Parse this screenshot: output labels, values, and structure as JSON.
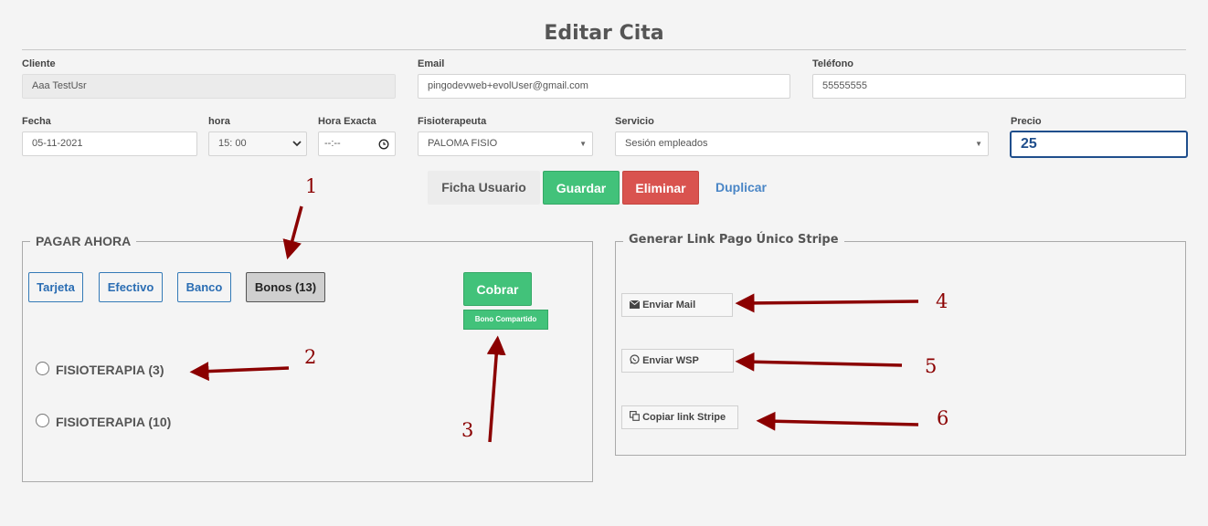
{
  "page": {
    "title": "Editar Cita"
  },
  "cliente": {
    "label": "Cliente",
    "value": "Aaa TestUsr"
  },
  "email": {
    "label": "Email",
    "value": "pingodevweb+evolUser@gmail.com"
  },
  "telefono": {
    "label": "Teléfono",
    "value": "55555555"
  },
  "fecha": {
    "label": "Fecha",
    "value": "05-11-2021"
  },
  "hora": {
    "label": "hora",
    "value": "15: 00"
  },
  "hora_exacta": {
    "label": "Hora Exacta",
    "value": "--:--"
  },
  "fisioterapeuta": {
    "label": "Fisioterapeuta",
    "value": "PALOMA FISIO"
  },
  "servicio": {
    "label": "Servicio",
    "value": "Sesión empleados"
  },
  "precio": {
    "label": "Precio",
    "value": "25"
  },
  "actions": {
    "ficha": "Ficha Usuario",
    "guardar": "Guardar",
    "eliminar": "Eliminar",
    "duplicar": "Duplicar"
  },
  "pagar": {
    "legend": "PAGAR AHORA",
    "methods": [
      "Tarjeta",
      "Efectivo",
      "Banco",
      "Bonos (13)"
    ],
    "cobrar": "Cobrar",
    "bono_compartido": "Bono Compartido",
    "options": [
      "FISIOTERAPIA (3)",
      "FISIOTERAPIA (10)"
    ]
  },
  "stripe": {
    "legend": "Generar Link Pago Único Stripe",
    "enviar_mail": "Enviar Mail",
    "enviar_wsp": "Enviar WSP",
    "copiar_link": "Copiar link Stripe"
  },
  "annotations": [
    "1",
    "2",
    "3",
    "4",
    "5",
    "6"
  ],
  "colors": {
    "primary": "#1f4e8c",
    "success": "#42c27a",
    "danger": "#d9534f",
    "link": "#4a86c6",
    "annotation": "#8b0000"
  }
}
